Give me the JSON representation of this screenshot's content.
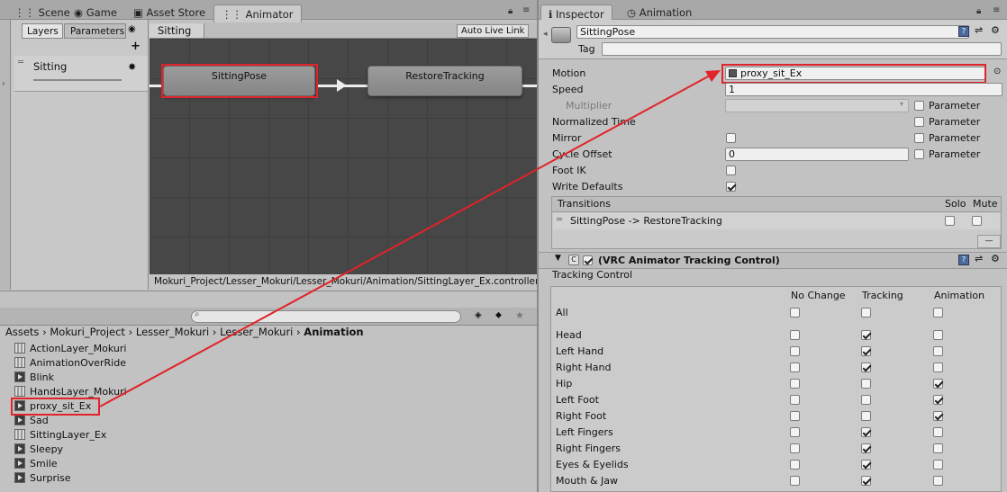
{
  "left_tabs": [
    "Scene",
    "Game",
    "Asset Store",
    "Animator"
  ],
  "right_tabs": [
    "Inspector",
    "Animation"
  ],
  "animator": {
    "subtabs": [
      "Layers",
      "Parameters"
    ],
    "add_symbol": "+",
    "layer_name": "Sitting",
    "breadcrumb": "Sitting",
    "auto_live_link": "Auto Live Link",
    "nodes": [
      "SittingPose",
      "RestoreTracking"
    ],
    "footer_path": "Mokuri_Project/Lesser_Mokuri/Lesser_Mokuri/Animation/SittingLayer_Ex.controller"
  },
  "project": {
    "search_placeholder": "",
    "breadcrumb": [
      "Assets",
      "Mokuri_Project",
      "Lesser_Mokuri",
      "Lesser_Mokuri",
      "Animation"
    ],
    "items": [
      {
        "name": "ActionLayer_Mokuri",
        "icon": "controller-icon"
      },
      {
        "name": "AnimationOverRide",
        "icon": "controller-icon"
      },
      {
        "name": "Blink",
        "icon": "animation-clip-icon"
      },
      {
        "name": "HandsLayer_Mokuri",
        "icon": "controller-icon"
      },
      {
        "name": "proxy_sit_Ex",
        "icon": "animation-clip-icon"
      },
      {
        "name": "Sad",
        "icon": "animation-clip-icon"
      },
      {
        "name": "SittingLayer_Ex",
        "icon": "controller-icon"
      },
      {
        "name": "Sleepy",
        "icon": "animation-clip-icon"
      },
      {
        "name": "Smile",
        "icon": "animation-clip-icon"
      },
      {
        "name": "Surprise",
        "icon": "animation-clip-icon"
      }
    ]
  },
  "inspector": {
    "state_name": "SittingPose",
    "tag_label": "Tag",
    "tag_value": "",
    "motion_label": "Motion",
    "motion_value": "proxy_sit_Ex",
    "speed_label": "Speed",
    "speed_value": "1",
    "multiplier_label": "Multiplier",
    "normalized_time_label": "Normalized Time",
    "mirror_label": "Mirror",
    "cycle_offset_label": "Cycle Offset",
    "cycle_offset_value": "0",
    "foot_ik_label": "Foot IK",
    "write_defaults_label": "Write Defaults",
    "write_defaults_checked": true,
    "parameter_label": "Parameter",
    "transitions_label": "Transitions",
    "solo_label": "Solo",
    "mute_label": "Mute",
    "transition": "SittingPose -> RestoreTracking",
    "minus_symbol": "—",
    "component_title": "(VRC Animator Tracking Control)",
    "tracking_control_label": "Tracking Control",
    "columns": [
      "No Change",
      "Tracking",
      "Animation"
    ],
    "all_label": "All",
    "rows": [
      {
        "label": "Head",
        "value": "Tracking"
      },
      {
        "label": "Left Hand",
        "value": "Tracking"
      },
      {
        "label": "Right Hand",
        "value": "Tracking"
      },
      {
        "label": "Hip",
        "value": "Animation"
      },
      {
        "label": "Left Foot",
        "value": "Animation"
      },
      {
        "label": "Right Foot",
        "value": "Animation"
      },
      {
        "label": "Left Fingers",
        "value": "Tracking"
      },
      {
        "label": "Right Fingers",
        "value": "Tracking"
      },
      {
        "label": "Eyes & Eyelids",
        "value": "Tracking"
      },
      {
        "label": "Mouth & Jaw",
        "value": "Tracking"
      }
    ]
  },
  "colors": {
    "highlight": "#e1232a"
  }
}
